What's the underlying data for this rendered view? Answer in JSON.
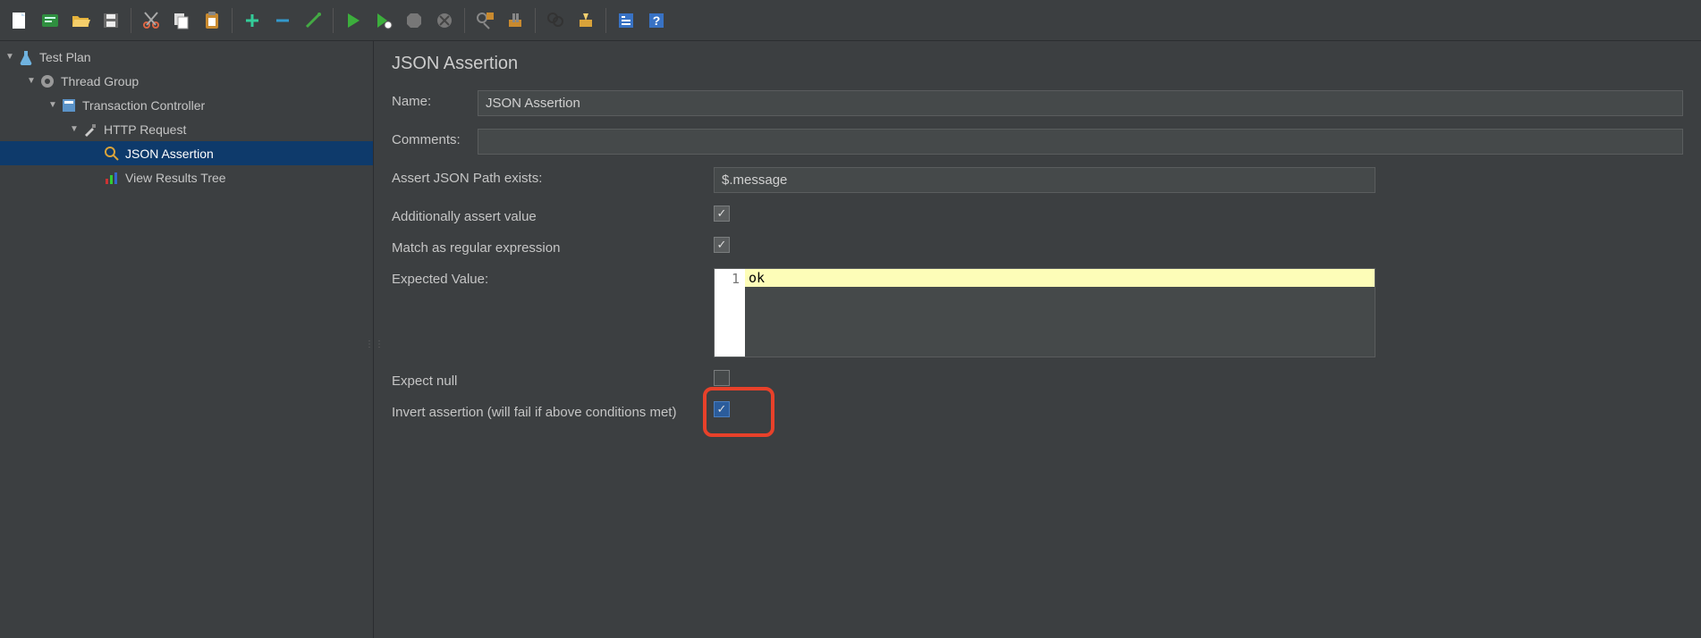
{
  "toolbar": {
    "icons": [
      "new-file-icon",
      "templates-icon",
      "open-icon",
      "save-icon",
      "sep",
      "cut-icon",
      "copy-icon",
      "paste-icon",
      "sep",
      "expand-icon",
      "collapse-icon",
      "toggle-icon",
      "sep",
      "run-icon",
      "run-no-timer-icon",
      "stop-icon",
      "shutdown-icon",
      "sep",
      "clear-icon",
      "clear-all-icon",
      "sep",
      "search-icon",
      "function-helper-icon",
      "sep",
      "options-icon",
      "help-icon"
    ]
  },
  "tree": {
    "items": [
      {
        "depth": 0,
        "expanded": true,
        "icon": "flask",
        "label": "Test Plan",
        "selected": false
      },
      {
        "depth": 1,
        "expanded": true,
        "icon": "gear",
        "label": "Thread Group",
        "selected": false
      },
      {
        "depth": 2,
        "expanded": true,
        "icon": "box",
        "label": "Transaction Controller",
        "selected": false
      },
      {
        "depth": 3,
        "expanded": true,
        "icon": "dropper",
        "label": "HTTP Request",
        "selected": false
      },
      {
        "depth": 4,
        "expanded": false,
        "icon": "magnifier",
        "label": "JSON Assertion",
        "selected": true
      },
      {
        "depth": 4,
        "expanded": false,
        "icon": "chart",
        "label": "View Results Tree",
        "selected": false
      }
    ]
  },
  "panel": {
    "title": "JSON Assertion",
    "name_label": "Name:",
    "name_value": "JSON Assertion",
    "comments_label": "Comments:",
    "comments_value": "",
    "path_label": "Assert JSON Path exists:",
    "path_value": "$.message",
    "assert_value_label": "Additionally assert value",
    "assert_value_checked": true,
    "regex_label": "Match as regular expression",
    "regex_checked": true,
    "expected_label": "Expected Value:",
    "expected_line_number": "1",
    "expected_value": "ok",
    "expect_null_label": "Expect null",
    "expect_null_checked": false,
    "invert_label": "Invert assertion (will fail if above conditions met)",
    "invert_checked": true
  }
}
